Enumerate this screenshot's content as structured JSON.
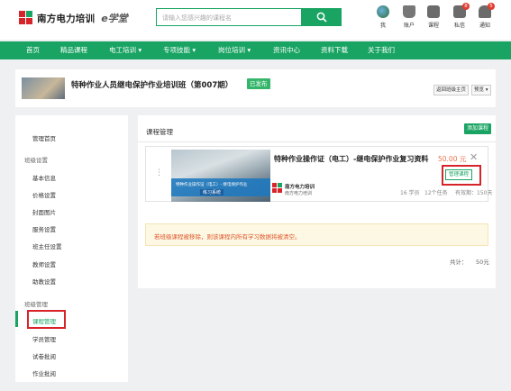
{
  "brand": {
    "name": "南方电力培训",
    "sub": "e学堂",
    "colors": {
      "primary": "#19a463",
      "red": "#d7242a",
      "orange": "#e8734a"
    }
  },
  "search": {
    "placeholder": "请输入您感兴趣的课程名"
  },
  "top_icons": [
    {
      "icon": "avatar-icon",
      "label": "我"
    },
    {
      "icon": "account-icon",
      "label": "账户"
    },
    {
      "icon": "course-icon",
      "label": "课程"
    },
    {
      "icon": "message-icon",
      "label": "私信",
      "badge": "8"
    },
    {
      "icon": "notification-icon",
      "label": "通知",
      "badge": "5"
    }
  ],
  "nav": {
    "items": [
      {
        "label": "首页"
      },
      {
        "label": "精品课程"
      },
      {
        "label": "电工培训 ▾"
      },
      {
        "label": "专项技能 ▾"
      },
      {
        "label": "岗位培训 ▾"
      },
      {
        "label": "资讯中心"
      },
      {
        "label": "资料下载"
      },
      {
        "label": "关于我们"
      }
    ]
  },
  "course_header": {
    "title": "特种作业人员继电保护作业培训班（第007期）",
    "status": "已发布",
    "back_button": "返回班级主页",
    "preview_button": "预览 ▾"
  },
  "sidebar": {
    "items": [
      {
        "label": "管理首页",
        "type": "item"
      },
      {
        "label": "班级设置",
        "type": "group"
      },
      {
        "label": "基本信息",
        "type": "item"
      },
      {
        "label": "价格设置",
        "type": "item"
      },
      {
        "label": "封面图片",
        "type": "item"
      },
      {
        "label": "服务设置",
        "type": "item"
      },
      {
        "label": "班主任设置",
        "type": "item"
      },
      {
        "label": "教师设置",
        "type": "item"
      },
      {
        "label": "助教设置",
        "type": "item"
      },
      {
        "label": "班级管理",
        "type": "group"
      },
      {
        "label": "课程管理",
        "type": "item",
        "active": true
      },
      {
        "label": "学员管理",
        "type": "item"
      },
      {
        "label": "试卷批阅",
        "type": "item"
      },
      {
        "label": "作业批阅",
        "type": "item"
      }
    ]
  },
  "main": {
    "title": "课程管理",
    "add_button": "添加课程",
    "course": {
      "image_band_text": "特种作业操作证（电工）- 继电保护作业",
      "image_band_button": "练习系统",
      "title": "特种作业操作证（电工）-继电保护作业复习资料",
      "price": "50.00 元",
      "manage_button": "管理课程",
      "logo_title": "南方电力培训",
      "logo_sub": "南方电力培训",
      "students": "16 学员",
      "tasks": "12个任务",
      "validity": "有效期：150天"
    },
    "notice": "若班级课程被移除，则该课程内所有学习数据将被清空。",
    "total_label": "共计：",
    "total_value": "50元"
  }
}
